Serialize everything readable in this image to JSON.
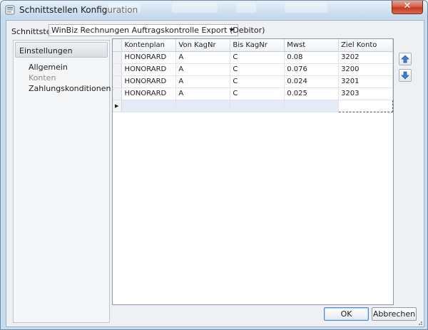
{
  "window": {
    "title": "Schnittstellen Konfiguration",
    "close_label": "✕"
  },
  "interface": {
    "label": "Schnittstelle",
    "selected": "WinBiz Rechnungen Auftragskontrolle Export (Debitor)"
  },
  "nav": {
    "header": "Einstellungen",
    "items": [
      {
        "label": "Allgemein",
        "active": false
      },
      {
        "label": "Konten",
        "active": true
      },
      {
        "label": "Zahlungskonditionen",
        "active": false
      }
    ]
  },
  "grid": {
    "columns": [
      "Kontenplan",
      "Von KagNr",
      "Bis KagNr",
      "Mwst",
      "Ziel Konto"
    ],
    "rows": [
      [
        "HONORARD",
        "A",
        "C",
        "0.08",
        "3202"
      ],
      [
        "HONORARD",
        "A",
        "C",
        "0.076",
        "3200"
      ],
      [
        "HONORARD",
        "A",
        "C",
        "0.024",
        "3201"
      ],
      [
        "HONORARD",
        "A",
        "C",
        "0.025",
        "3203"
      ]
    ]
  },
  "buttons": {
    "ok": "OK",
    "cancel": "Abbrechen"
  },
  "icons": {
    "move_up": "arrow-up-icon",
    "move_down": "arrow-down-icon"
  },
  "colors": {
    "accent": "#3f7fd0",
    "close": "#c4391f"
  }
}
